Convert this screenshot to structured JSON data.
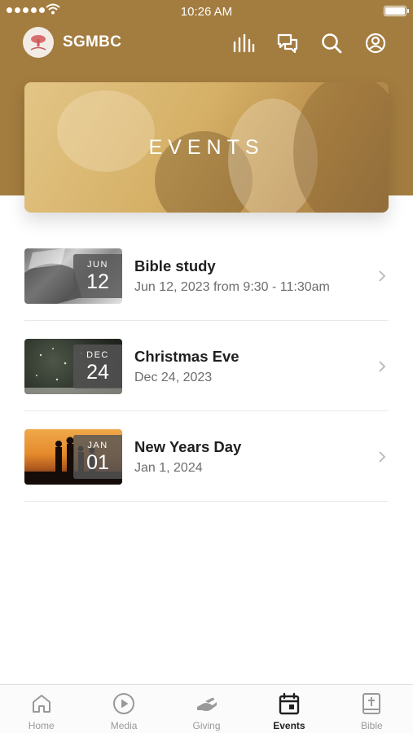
{
  "status_bar": {
    "time": "10:26 AM"
  },
  "header": {
    "app_name": "SGMBC"
  },
  "hero": {
    "title": "EVENTS"
  },
  "events": [
    {
      "title": "Bible study",
      "date_text": "Jun 12, 2023 from 9:30 - 11:30am",
      "badge_month": "JUN",
      "badge_day": "12"
    },
    {
      "title": "Christmas Eve",
      "date_text": "Dec 24, 2023",
      "badge_month": "DEC",
      "badge_day": "24"
    },
    {
      "title": "New Years Day",
      "date_text": "Jan 1, 2024",
      "badge_month": "JAN",
      "badge_day": "01"
    }
  ],
  "tabs": [
    {
      "label": "Home",
      "icon": "home-icon"
    },
    {
      "label": "Media",
      "icon": "play-circle-icon"
    },
    {
      "label": "Giving",
      "icon": "giving-hand-icon"
    },
    {
      "label": "Events",
      "icon": "calendar-icon",
      "active": true
    },
    {
      "label": "Bible",
      "icon": "bible-icon"
    }
  ],
  "colors": {
    "brand": "#a37c3f",
    "active_tab": "#1f1f1f",
    "inactive_tab": "#999999"
  }
}
